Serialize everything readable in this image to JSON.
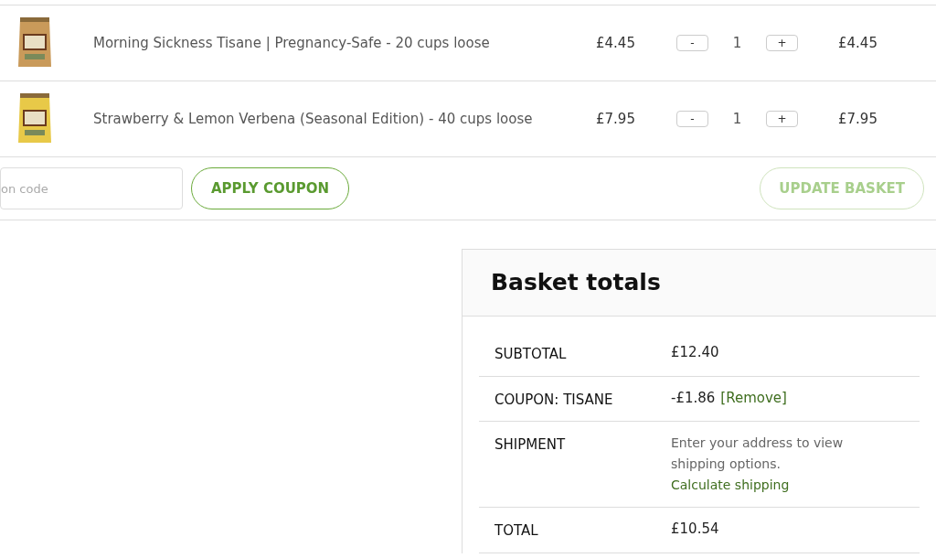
{
  "basket": {
    "items": [
      {
        "name": "Morning Sickness Tisane | Pregnancy-Safe - 20 cups loose",
        "price": "£4.45",
        "minus": "-",
        "quantity": "1",
        "plus": "+",
        "subtotal": "£4.45"
      },
      {
        "name": "Strawberry & Lemon Verbena (Seasonal Edition) - 40 cups loose",
        "price": "£7.95",
        "minus": "-",
        "quantity": "1",
        "plus": "+",
        "subtotal": "£7.95"
      }
    ],
    "coupon": {
      "placeholder": "on code",
      "apply": "APPLY COUPON"
    },
    "update": {
      "label": "UPDATE BASKET",
      "disabled": true
    }
  },
  "totals": {
    "title": "Basket totals",
    "rows": [
      {
        "kind": "amount",
        "label": "SUBTOTAL",
        "value": "£12.40"
      },
      {
        "kind": "coupon",
        "label": "COUPON: TISANE",
        "value": "-£1.86",
        "link": "[Remove]"
      },
      {
        "kind": "shipping",
        "label": "SHIPMENT",
        "value": "Enter your address to view shipping options.",
        "link": "Calculate shipping"
      },
      {
        "kind": "amount",
        "label": "TOTAL",
        "value": "£10.54"
      }
    ]
  }
}
